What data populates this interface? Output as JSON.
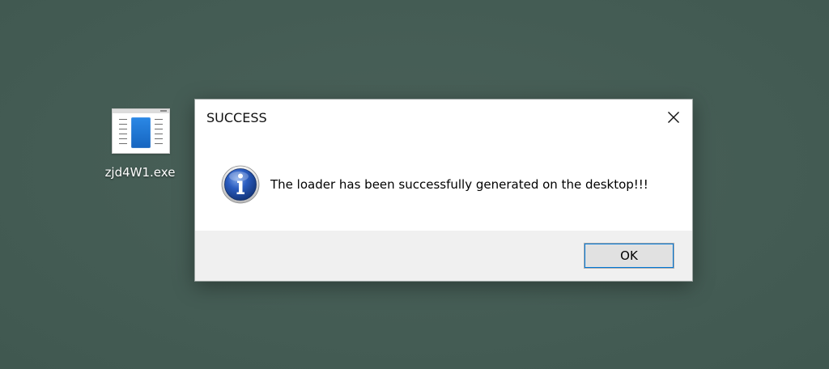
{
  "desktop": {
    "icon": {
      "label": "zjd4W1.exe",
      "icon_name": "document-icon"
    }
  },
  "dialog": {
    "title": "SUCCESS",
    "close_icon": "close-icon",
    "icon": "information-icon",
    "message": "The loader has been successfully generated on the desktop!!!",
    "ok_label": "OK"
  },
  "colors": {
    "desktop_background": "#445c54",
    "dialog_background": "#ffffff",
    "footer_background": "#f0f0f0",
    "focus_outline": "#0078d7",
    "info_icon_blue": "#1d4fa6"
  }
}
